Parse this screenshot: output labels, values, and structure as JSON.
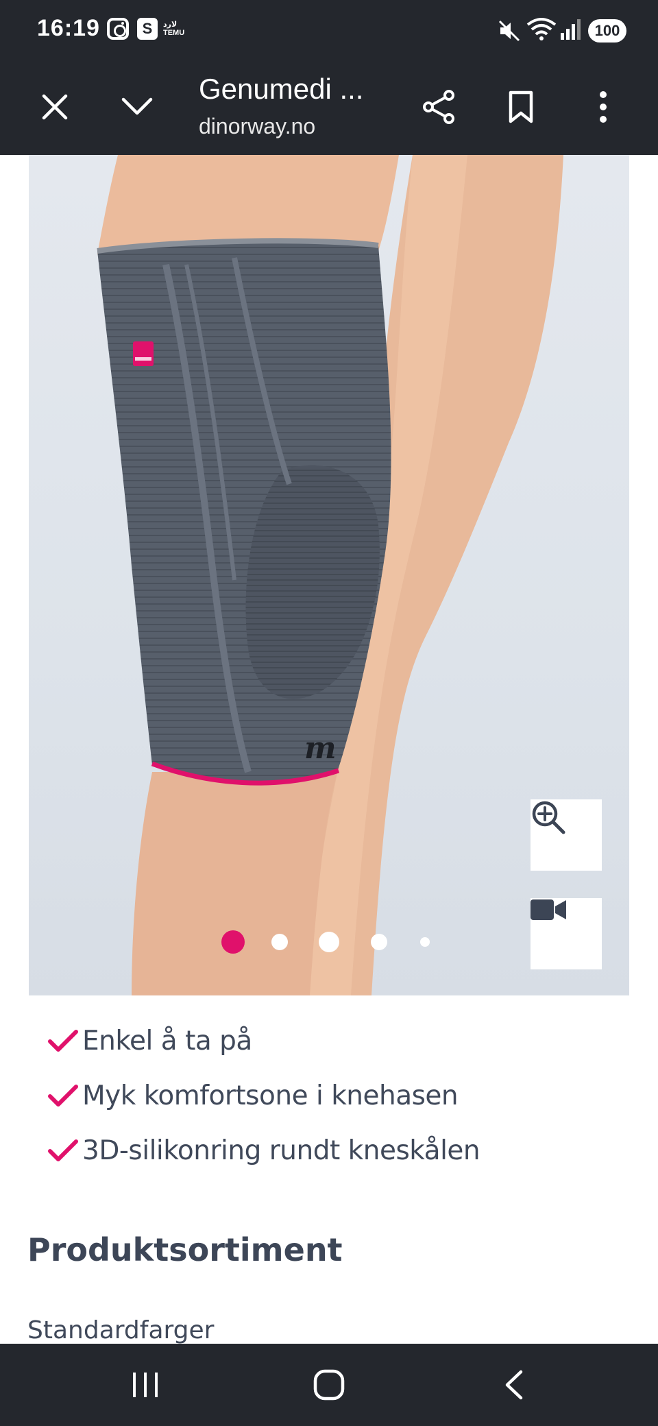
{
  "status_bar": {
    "time": "16:19",
    "s_icon_letter": "S",
    "temu_label": "لارد\nTEMU",
    "battery": "100",
    "icons": [
      "instagram-icon",
      "s-app-icon",
      "temu-icon",
      "mute-icon",
      "wifi-icon",
      "signal-icon",
      "battery-icon"
    ]
  },
  "browser": {
    "title": "Genumedi ...",
    "url": "dinorway.no",
    "buttons": [
      "close-icon",
      "chevron-down-icon",
      "share-icon",
      "bookmark-icon",
      "more-icon"
    ]
  },
  "gallery": {
    "total_slides": 5,
    "active_slide": 1,
    "controls": [
      "zoom-in-icon",
      "video-icon"
    ]
  },
  "features": [
    "Enkel å ta på",
    "Myk komfortsone i knehasen",
    "3D-silikonring rundt kneskålen"
  ],
  "section": {
    "title": "Produktsortiment",
    "subtitle": "Standardfarger"
  },
  "colors": {
    "accent": "#e0116b",
    "system_bar": "#24272d",
    "text": "#40495a"
  }
}
